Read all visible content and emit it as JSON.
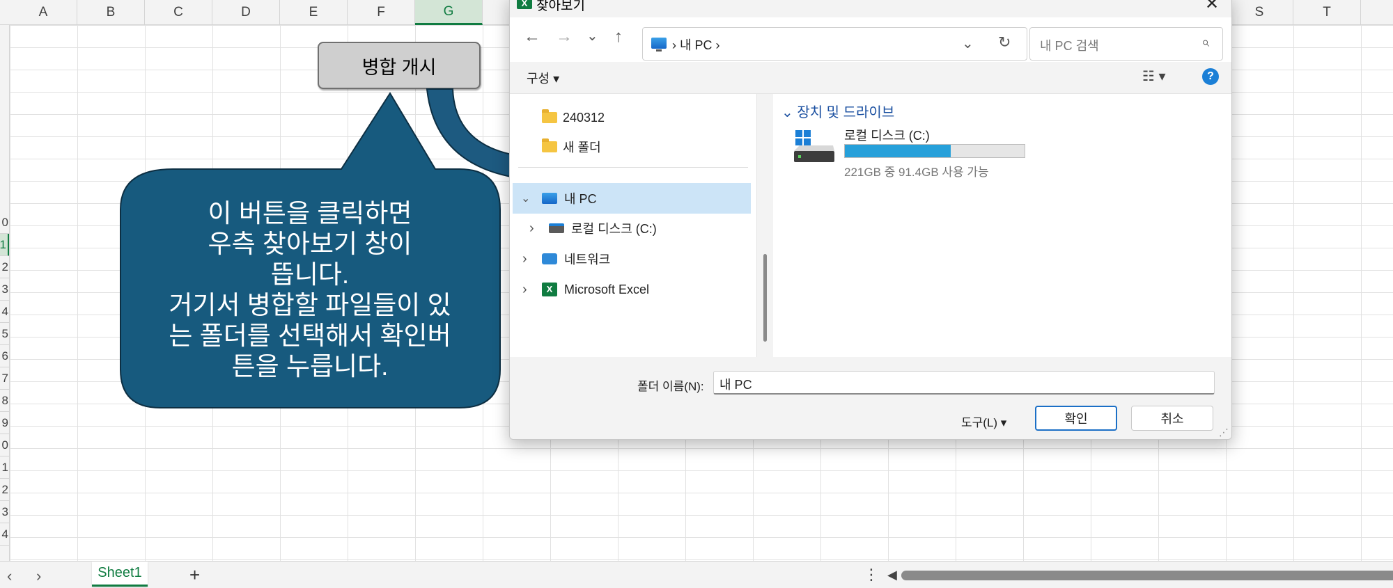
{
  "sheet": {
    "columns": [
      "A",
      "B",
      "C",
      "D",
      "E",
      "F",
      "G",
      "",
      "",
      "",
      "",
      "",
      "",
      "",
      "",
      "",
      "",
      "",
      "S",
      "T",
      ""
    ],
    "selected_column": "G",
    "rows": [
      "0",
      "1",
      "2",
      "3",
      "4",
      "5",
      "6",
      "7",
      "8",
      "9",
      "0",
      "1",
      "2",
      "3",
      "4"
    ],
    "selected_row_index": 1,
    "tab_name": "Sheet1",
    "add_sheet_label": "+",
    "nav_prev": "‹",
    "nav_next": "›",
    "tab_options": "⋮",
    "scroll_left": "◀"
  },
  "merge_button": {
    "label": "병합 개시"
  },
  "callout": {
    "lines": [
      "이 버튼을 클릭하면",
      "우측 찾아보기 창이",
      "뜹니다.",
      "거기서 병합할 파일들이 있",
      "는 폴더를 선택해서 확인버",
      "튼을 누릅니다."
    ],
    "fill_color": "#175a7e",
    "arrow_color": "#1d5a80"
  },
  "dialog": {
    "title": "찾아보기",
    "title_icon": "X",
    "close": "✕",
    "nav": {
      "back": "←",
      "forward": "→",
      "recent": "⌄",
      "up": "↑"
    },
    "address": "›  내 PC  ›",
    "address_dropdown": "⌄",
    "refresh": "↻",
    "search_placeholder": "내 PC 검색",
    "search_icon": "⌕",
    "toolbar": {
      "organize": "구성 ▾",
      "view": "☷ ▾",
      "help": "?"
    },
    "tree": [
      {
        "label": "240312",
        "type": "folder"
      },
      {
        "label": "새 폴더",
        "type": "folder"
      },
      {
        "label": "내 PC",
        "type": "pc",
        "expanded_marker": "⌄"
      },
      {
        "label": "로컬 디스크 (C:)",
        "type": "disk",
        "collapsed_marker": "›"
      },
      {
        "label": "네트워크",
        "type": "network",
        "collapsed_marker": "›"
      },
      {
        "label": "Microsoft Excel",
        "type": "excel",
        "collapsed_marker": "›"
      }
    ],
    "content": {
      "group_header": "⌄  장치 및 드라이브",
      "drive_name": "로컬 디스크 (C:)",
      "drive_free_text": "221GB 중 91.4GB 사용 가능",
      "drive_used_fraction": 0.59
    },
    "folder_label": "폴더 이름(N):",
    "folder_value": "내 PC",
    "tools_label": "도구(L)  ▾",
    "ok_label": "확인",
    "cancel_label": "취소",
    "resize_grip": "⋰"
  }
}
